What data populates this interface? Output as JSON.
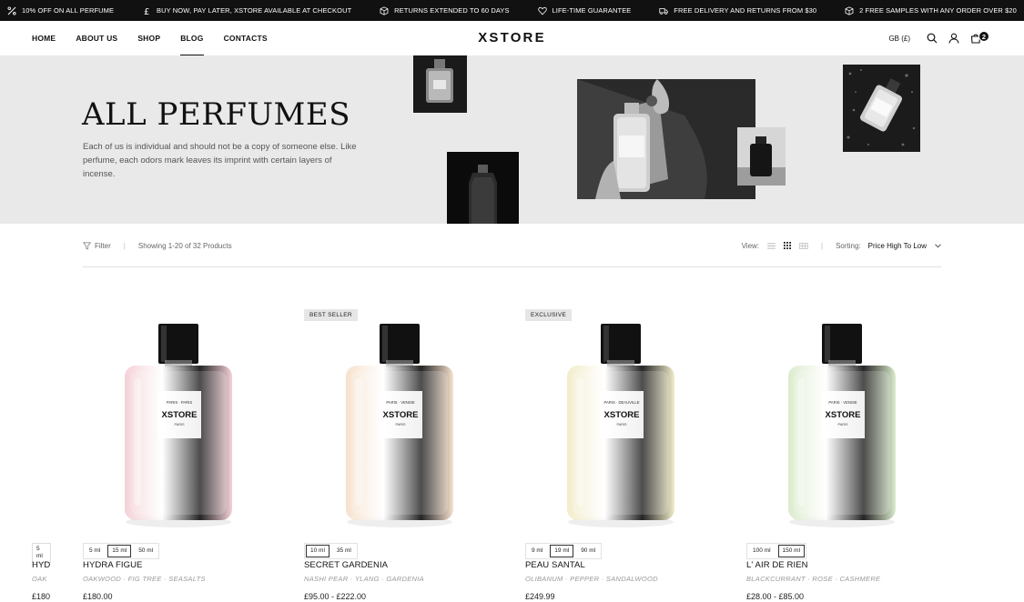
{
  "promo": [
    {
      "icon": "percent-icon",
      "text": "10% OFF ON ALL PERFUME"
    },
    {
      "icon": "pound-icon",
      "text": "BUY NOW, PAY LATER, XSTORE AVAILABLE AT CHECKOUT"
    },
    {
      "icon": "box-icon",
      "text": "RETURNS EXTENDED TO 60 DAYS"
    },
    {
      "icon": "heart-icon",
      "text": "LIFE-TIME GUARANTEE"
    },
    {
      "icon": "truck-icon",
      "text": "FREE DELIVERY AND RETURNS FROM $30"
    },
    {
      "icon": "gift-icon",
      "text": "2 FREE SAMPLES WITH ANY ORDER OVER $20"
    }
  ],
  "nav": {
    "items": [
      "HOME",
      "ABOUT US",
      "SHOP",
      "BLOG",
      "CONTACTS"
    ],
    "active": "BLOG"
  },
  "logo": "XSTORE",
  "header": {
    "currency": "GB (£)",
    "cart_count": "2"
  },
  "hero": {
    "title": "ALL PERFUMES",
    "text": "Each of us is individual and should not be a copy of someone else. Like perfume, each odors mark leaves its imprint with certain layers of incense."
  },
  "toolbar": {
    "filter_label": "Filter",
    "showing": "Showing 1-20 of 32 Products",
    "view_label": "View:",
    "sorting_label": "Sorting:",
    "sorting_value": "Price High To Low"
  },
  "partial_product": {
    "size": "5 ml",
    "name": "HYD",
    "notes": "OAK",
    "price": "£180"
  },
  "products": [
    {
      "badge": "",
      "label_top": "PARIS · PARIS",
      "brand": "XSTORE",
      "label_bottom": "PARIS",
      "sizes": [
        "5 ml",
        "15 ml",
        "50 ml"
      ],
      "active_size": "15 ml",
      "name": "HYDRA FIGUE",
      "notes": "OAKWOOD · FIG TREE · SEASALTS",
      "price": "£180.00",
      "tint": "#f2c9d0"
    },
    {
      "badge": "BEST SELLER",
      "label_top": "PARIS · VENISE",
      "brand": "XSTORE",
      "label_bottom": "PARIS",
      "sizes": [
        "10 ml",
        "35 ml"
      ],
      "active_size": "10 ml",
      "name": "SECRET GARDENIA",
      "notes": "NASHI PEAR · YLANG · GARDENIA",
      "price": "£95.00 - £222.00",
      "tint": "#f5dcc5"
    },
    {
      "badge": "EXCLUSIVE",
      "label_top": "PARIS · DEAUVILLE",
      "brand": "XSTORE",
      "label_bottom": "PARIS",
      "sizes": [
        "9 ml",
        "19 ml",
        "90 ml"
      ],
      "active_size": "19 ml",
      "name": "PEAU SANTAL",
      "notes": "OLIBANUM · PEPPER · SANDALWOOD",
      "price": "£249.99",
      "tint": "#efe9c0"
    },
    {
      "badge": "",
      "label_top": "PARIS · VENISE",
      "brand": "XSTORE",
      "label_bottom": "PARIS",
      "sizes": [
        "100 ml",
        "150 ml"
      ],
      "active_size": "150 ml",
      "name": "L' AIR DE RIEN",
      "notes": "BLACKCURRANT · ROSE · CASHMERE",
      "price": "£28.00 - £85.00",
      "tint": "#d5e8c4"
    }
  ]
}
